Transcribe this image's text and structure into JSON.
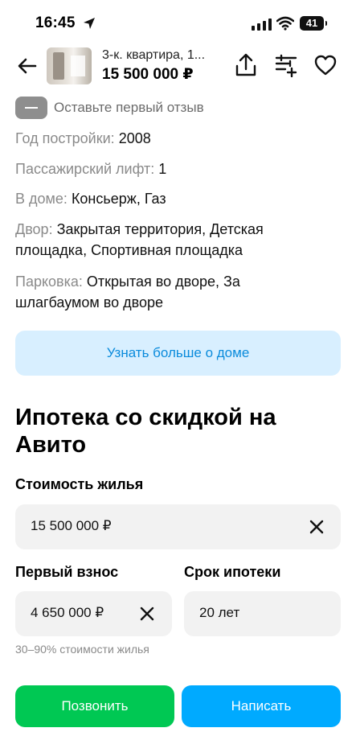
{
  "status_bar": {
    "time": "16:45",
    "battery": "41"
  },
  "header": {
    "title": "3-к. квартира, 1...",
    "price": "15 500 000 ₽",
    "icons": [
      "back-arrow-icon",
      "share-icon",
      "compare-icon",
      "heart-icon"
    ]
  },
  "rating": {
    "text": "Оставьте первый отзыв"
  },
  "house_info": [
    {
      "label": "Год постройки:",
      "value": "2008"
    },
    {
      "label": "Пассажирский лифт:",
      "value": "1"
    },
    {
      "label": "В доме:",
      "value": "Консьерж, Газ"
    },
    {
      "label": "Двор:",
      "value": "Закрытая территория, Детская площадка, Спортивная площадка"
    },
    {
      "label": "Парковка:",
      "value": "Открытая во дворе, За шлагбаумом во дворе"
    }
  ],
  "more_button": "Узнать больше о доме",
  "mortgage": {
    "title": "Ипотека со скидкой на Авито",
    "cost_label": "Стоимость жилья",
    "cost_value": "15 500 000 ₽",
    "down_payment_label": "Первый взнос",
    "down_payment_value": "4 650 000 ₽",
    "term_label": "Срок ипотеки",
    "term_value": "20 лет",
    "down_payment_hint": "30–90% стоимости жилья"
  },
  "actions": {
    "call": "Позвонить",
    "write": "Написать"
  },
  "colors": {
    "call_green": "#00c853",
    "write_blue": "#00aaff",
    "info_blue_bg": "#d8efff",
    "info_blue_text": "#0a8bdc"
  }
}
